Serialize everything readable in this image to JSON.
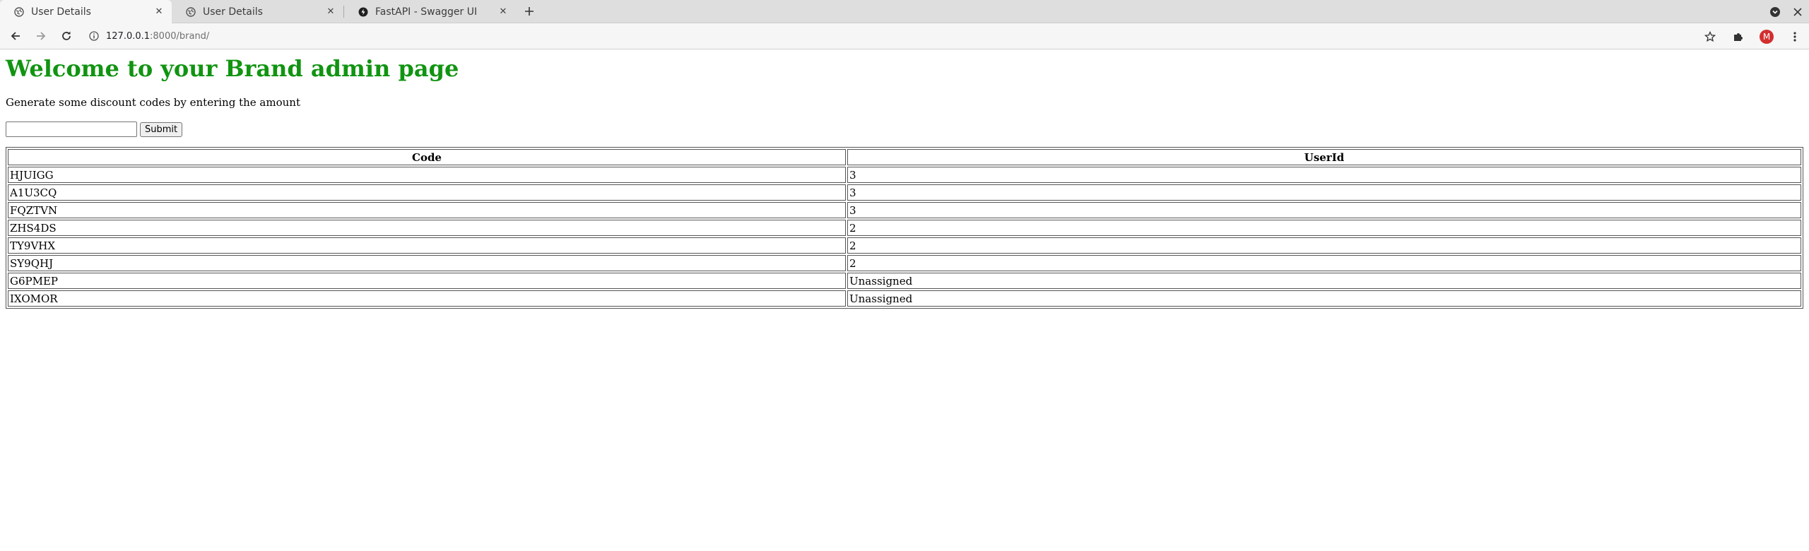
{
  "browser": {
    "tabs": [
      {
        "title": "User Details",
        "active": true,
        "favicon": "globe-icon"
      },
      {
        "title": "User Details",
        "active": false,
        "favicon": "globe-icon"
      },
      {
        "title": "FastAPI - Swagger UI",
        "active": false,
        "favicon": "fastapi-icon"
      }
    ],
    "url": {
      "host": "127.0.0.1",
      "rest": ":8000/brand/"
    },
    "profile_initial": "M"
  },
  "page": {
    "heading": "Welcome to your Brand admin page",
    "description": "Generate some discount codes by entering the amount",
    "amount_input": {
      "value": "",
      "placeholder": ""
    },
    "submit_label": "Submit"
  },
  "table": {
    "headers": [
      "Code",
      "UserId"
    ],
    "rows": [
      {
        "code": "HJUIGG",
        "user_id": "3"
      },
      {
        "code": "A1U3CQ",
        "user_id": "3"
      },
      {
        "code": "FQZTVN",
        "user_id": "3"
      },
      {
        "code": "ZHS4DS",
        "user_id": "2"
      },
      {
        "code": "TY9VHX",
        "user_id": "2"
      },
      {
        "code": "SY9QHJ",
        "user_id": "2"
      },
      {
        "code": "G6PMEP",
        "user_id": "Unassigned"
      },
      {
        "code": "IXOMOR",
        "user_id": "Unassigned"
      }
    ]
  },
  "colors": {
    "heading": "#119411",
    "profile_avatar": "#d32f2f"
  }
}
